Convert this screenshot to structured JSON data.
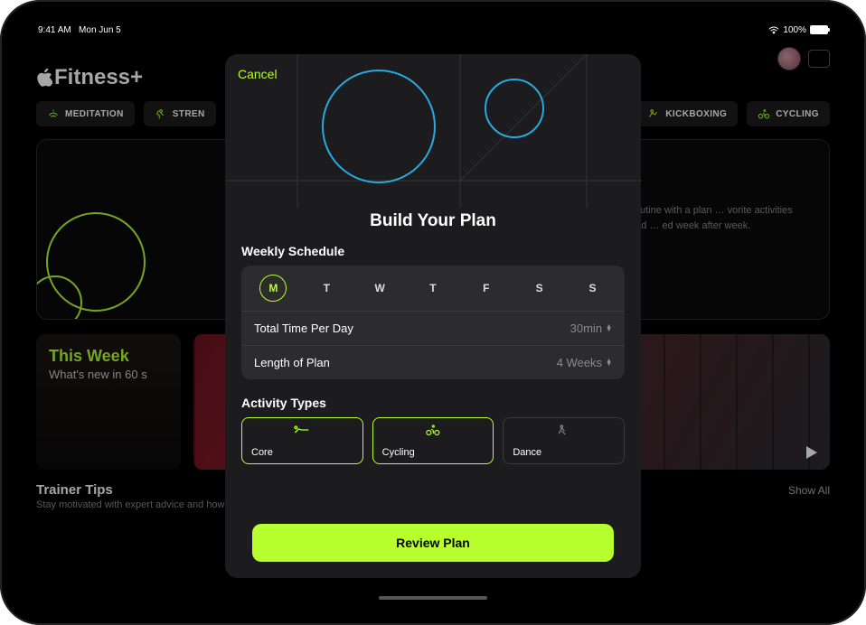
{
  "status": {
    "time": "9:41 AM",
    "date": "Mon Jun 5",
    "battery": "100%"
  },
  "app": {
    "logo": "Fitness+",
    "chips": [
      "MEDITATION",
      "STREN",
      "KICKBOXING",
      "CYCLING"
    ],
    "hero_text": "…utine with a plan … vorite activities and … ed week after week.",
    "week": {
      "title": "This Week",
      "subtitle": "What's new in 60 s"
    },
    "tips": {
      "title": "Trainer Tips",
      "subtitle": "Stay motivated with expert advice and how-to demos from the Fitness+ trainer team",
      "show_all": "Show All"
    }
  },
  "modal": {
    "cancel": "Cancel",
    "title": "Build Your Plan",
    "sections": {
      "schedule_label": "Weekly Schedule",
      "days": [
        "M",
        "T",
        "W",
        "T",
        "F",
        "S",
        "S"
      ],
      "selected_day_index": 0,
      "rows": [
        {
          "label": "Total Time Per Day",
          "value": "30min"
        },
        {
          "label": "Length of Plan",
          "value": "4 Weeks"
        }
      ],
      "activity_label": "Activity Types",
      "activities": [
        {
          "label": "Core",
          "selected": true
        },
        {
          "label": "Cycling",
          "selected": true
        },
        {
          "label": "Dance",
          "selected": false
        }
      ]
    },
    "review": "Review Plan"
  }
}
